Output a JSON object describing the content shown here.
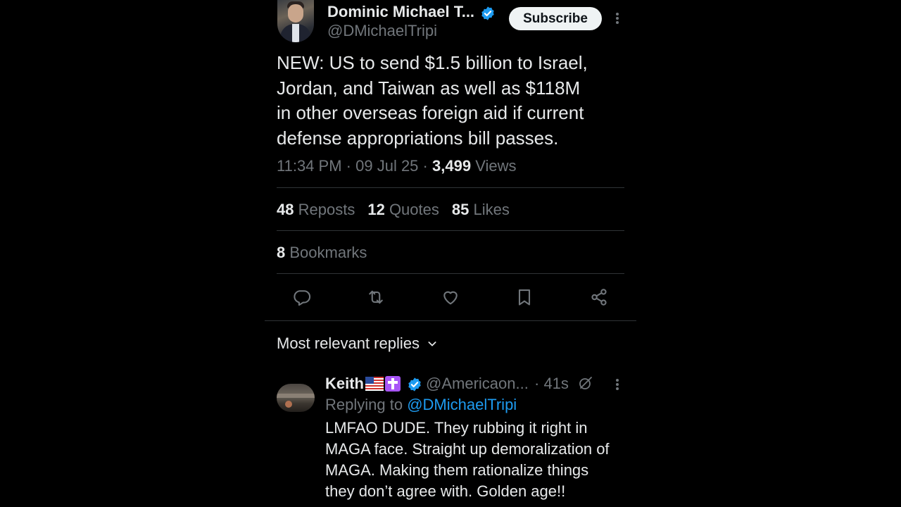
{
  "tweet": {
    "author_name": "Dominic Michael T...",
    "author_handle": "@DMichaelTripi",
    "subscribe_label": "Subscribe",
    "text": "NEW: US to send $1.5 billion to Israel,\nJordan, and Taiwan as well as $118M\nin other overseas foreign aid if current\ndefense appropriations bill passes.",
    "time": "11:34 PM",
    "date": "09 Jul 25",
    "views_count": "3,499",
    "views_label": "Views",
    "separator": "·"
  },
  "stats": {
    "reposts_count": "48",
    "reposts_label": "Reposts",
    "quotes_count": "12",
    "quotes_label": "Quotes",
    "likes_count": "85",
    "likes_label": "Likes",
    "bookmarks_count": "8",
    "bookmarks_label": "Bookmarks"
  },
  "actions": [
    "reply-icon",
    "repost-icon",
    "like-icon",
    "bookmark-icon",
    "share-icon"
  ],
  "replies": {
    "sort_label": "Most relevant replies",
    "items": [
      {
        "name": "Keith",
        "handle": "@Americaon...",
        "time": "· 41s",
        "replying_prefix": "Replying to",
        "replying_to": "@DMichaelTripi",
        "text": "LMFAO DUDE. They rubbing it right in\nMAGA face. Straight up demoralization of\nMAGA. Making them rationalize things\nthey don’t agree with. Golden age!!"
      }
    ]
  },
  "colors": {
    "background": "#000000",
    "text_primary": "#e7e9ea",
    "text_secondary": "#71767b",
    "accent_blue": "#1d9bf0",
    "divider": "#2f3336"
  }
}
